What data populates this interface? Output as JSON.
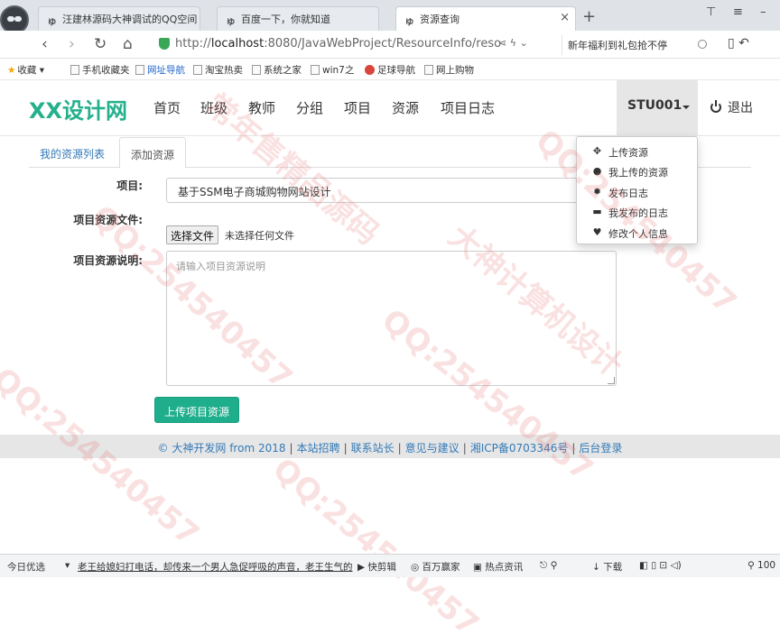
{
  "browser": {
    "tabs": [
      {
        "title": "汪建林源码大神调试的QQ空间 [",
        "active": false
      },
      {
        "title": "百度一下，你就知道",
        "active": false
      },
      {
        "title": "资源查询",
        "active": true
      }
    ],
    "url_prefix": "http://",
    "url_host": "localhost",
    "url_rest": ":8080/JavaWebProject/ResourceInfo/reso",
    "search_text": "新年福利到礼包抢不停",
    "bookmarks": [
      {
        "label": "收藏"
      },
      {
        "label": "手机收藏夹"
      },
      {
        "label": "网址导航"
      },
      {
        "label": "淘宝热卖"
      },
      {
        "label": "系统之家"
      },
      {
        "label": "win7之"
      },
      {
        "label": "足球导航"
      },
      {
        "label": "网上购物"
      }
    ]
  },
  "site": {
    "brand": "XX设计网",
    "nav": [
      "首页",
      "班级",
      "教师",
      "分组",
      "项目",
      "资源",
      "项目日志"
    ],
    "user": "STU001",
    "logout": "退出",
    "dropdown": [
      "上传资源",
      "我上传的资源",
      "发布日志",
      "我发布的日志",
      "修改个人信息"
    ]
  },
  "content": {
    "tabs": [
      "我的资源列表",
      "添加资源"
    ],
    "form": {
      "project_label": "项目:",
      "project_value": "基于SSM电子商城购物网站设计",
      "file_label": "项目资源文件:",
      "file_button": "选择文件",
      "file_status": "未选择任何文件",
      "desc_label": "项目资源说明:",
      "desc_placeholder": "请输入项目资源说明",
      "submit": "上传项目资源"
    }
  },
  "footer": {
    "items": [
      "© 大神开发网 from 2018",
      "本站招聘",
      "联系站长",
      "意见与建议",
      "湘ICP备0703346号",
      "后台登录"
    ]
  },
  "statusbar": {
    "left": "今日优选",
    "news": "老王给媳妇打电话，却传来一个男人急促呼吸的声音，老王生气的",
    "items": [
      "快剪辑",
      "百万赢家",
      "热点资讯"
    ],
    "right": [
      "下载",
      "100"
    ]
  },
  "watermarks": [
    "QQ:254540457",
    "大神计算机设计",
    "常年售精品源码"
  ]
}
